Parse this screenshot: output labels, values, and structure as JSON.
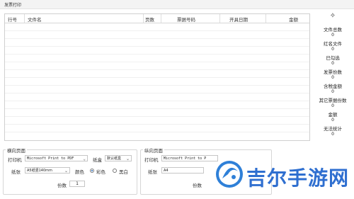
{
  "window": {
    "title": "发票打印"
  },
  "table": {
    "headers": [
      "行号",
      "文件名",
      "页数",
      "票据号码",
      "开具日期",
      "金额"
    ]
  },
  "stats": {
    "settings_icon": "gear-icon",
    "items": [
      {
        "label": "文件总数",
        "value": "0"
      },
      {
        "label": "红名文件",
        "value": "0"
      },
      {
        "label": "已勾选",
        "value": "0"
      },
      {
        "label": "发票份数",
        "value": "0"
      },
      {
        "label": "含税金额",
        "value": "0"
      },
      {
        "label": "其它票据份数",
        "value": "0"
      },
      {
        "label": "金额",
        "value": "0"
      },
      {
        "label": "无法统计",
        "value": "0"
      }
    ]
  },
  "landscape": {
    "title": "横向页面",
    "printer_label": "打印机",
    "printer_value": "Microsoft Print to PDF",
    "tray_label": "纸盒",
    "tray_value": "默认纸盒",
    "paper_label": "纸张",
    "paper_value": "A5纸竖140mm",
    "color_label": "颜色",
    "color_options": [
      "彩色",
      "黑白"
    ],
    "copies_label": "份数",
    "copies_value": "1"
  },
  "portrait": {
    "title": "纵向页面",
    "printer_label": "打印机",
    "printer_value": "Microsoft Print to P",
    "paper_label": "纸张",
    "paper_value": "A4",
    "copies_label": "份数"
  },
  "watermark": {
    "text": "吉尔手游网"
  }
}
